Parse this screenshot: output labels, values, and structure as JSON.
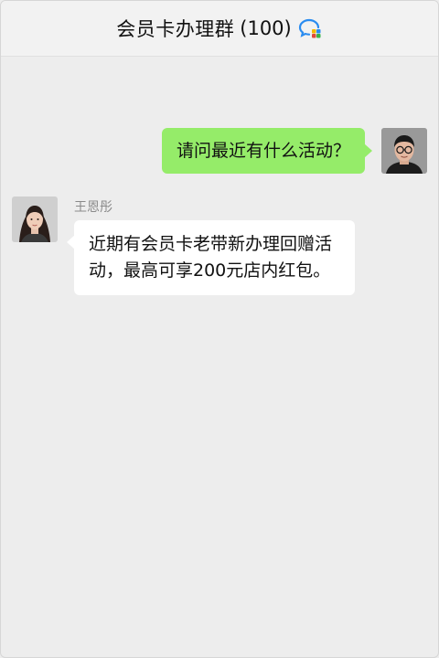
{
  "header": {
    "title": "会员卡办理群",
    "count": "(100)",
    "icon": "enterprise-chat-icon"
  },
  "messages": [
    {
      "direction": "outgoing",
      "text": "请问最近有什么活动？",
      "avatar": "man-glasses-avatar",
      "bubble_color": "#95ec69"
    },
    {
      "direction": "incoming",
      "sender": "王恩彤",
      "text": "近期有会员卡老带新办理回赠活动，最高可享200元店内红包。",
      "avatar": "woman-avatar",
      "bubble_color": "#ffffff"
    }
  ],
  "colors": {
    "background": "#ededed",
    "header": "#f2f2f2",
    "outgoing_bubble": "#95ec69",
    "incoming_bubble": "#ffffff"
  }
}
